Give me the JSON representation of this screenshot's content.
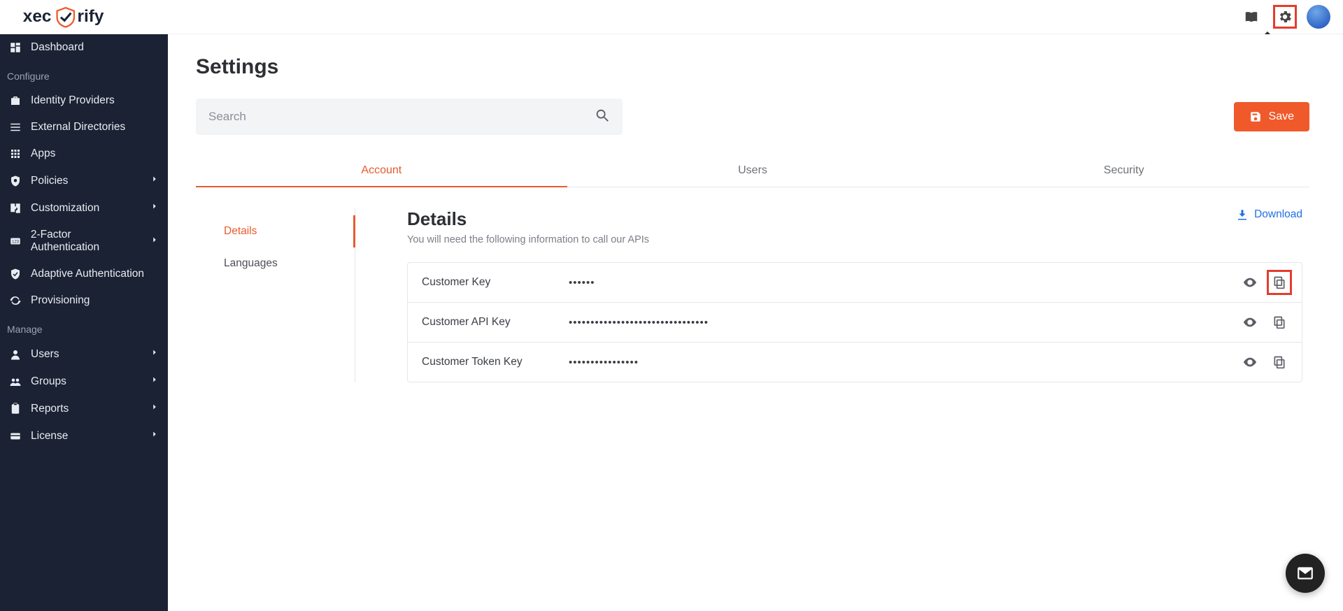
{
  "brand": "xecurify",
  "topbar": {
    "tooltip": "Settings"
  },
  "sidebar": {
    "sections": [
      {
        "label": null,
        "items": [
          {
            "label": "Dashboard",
            "icon": "dashboard",
            "chevron": false
          }
        ]
      },
      {
        "label": "Configure",
        "items": [
          {
            "label": "Identity Providers",
            "icon": "idp",
            "chevron": false
          },
          {
            "label": "External Directories",
            "icon": "list",
            "chevron": false
          },
          {
            "label": "Apps",
            "icon": "apps",
            "chevron": false
          },
          {
            "label": "Policies",
            "icon": "shield",
            "chevron": true
          },
          {
            "label": "Customization",
            "icon": "puzzle",
            "chevron": true
          },
          {
            "label": "2-Factor Authentication",
            "icon": "2fa",
            "chevron": true
          },
          {
            "label": "Adaptive Authentication",
            "icon": "shieldcheck",
            "chevron": false
          },
          {
            "label": "Provisioning",
            "icon": "sync",
            "chevron": false
          }
        ]
      },
      {
        "label": "Manage",
        "items": [
          {
            "label": "Users",
            "icon": "user",
            "chevron": true
          },
          {
            "label": "Groups",
            "icon": "groups",
            "chevron": true
          },
          {
            "label": "Reports",
            "icon": "clipboard",
            "chevron": true
          },
          {
            "label": "License",
            "icon": "card",
            "chevron": true
          }
        ]
      }
    ]
  },
  "page": {
    "title": "Settings",
    "search_placeholder": "Search",
    "save_label": "Save",
    "tabs": [
      "Account",
      "Users",
      "Security"
    ],
    "active_tab": 0,
    "subnav": [
      "Details",
      "Languages"
    ],
    "active_sub": 0,
    "details": {
      "heading": "Details",
      "subheading": "You will need the following information to call our APIs",
      "download_label": "Download",
      "rows": [
        {
          "label": "Customer Key",
          "masked": "••••••"
        },
        {
          "label": "Customer API Key",
          "masked": "••••••••••••••••••••••••••••••••"
        },
        {
          "label": "Customer Token Key",
          "masked": "••••••••••••••••"
        }
      ]
    }
  }
}
